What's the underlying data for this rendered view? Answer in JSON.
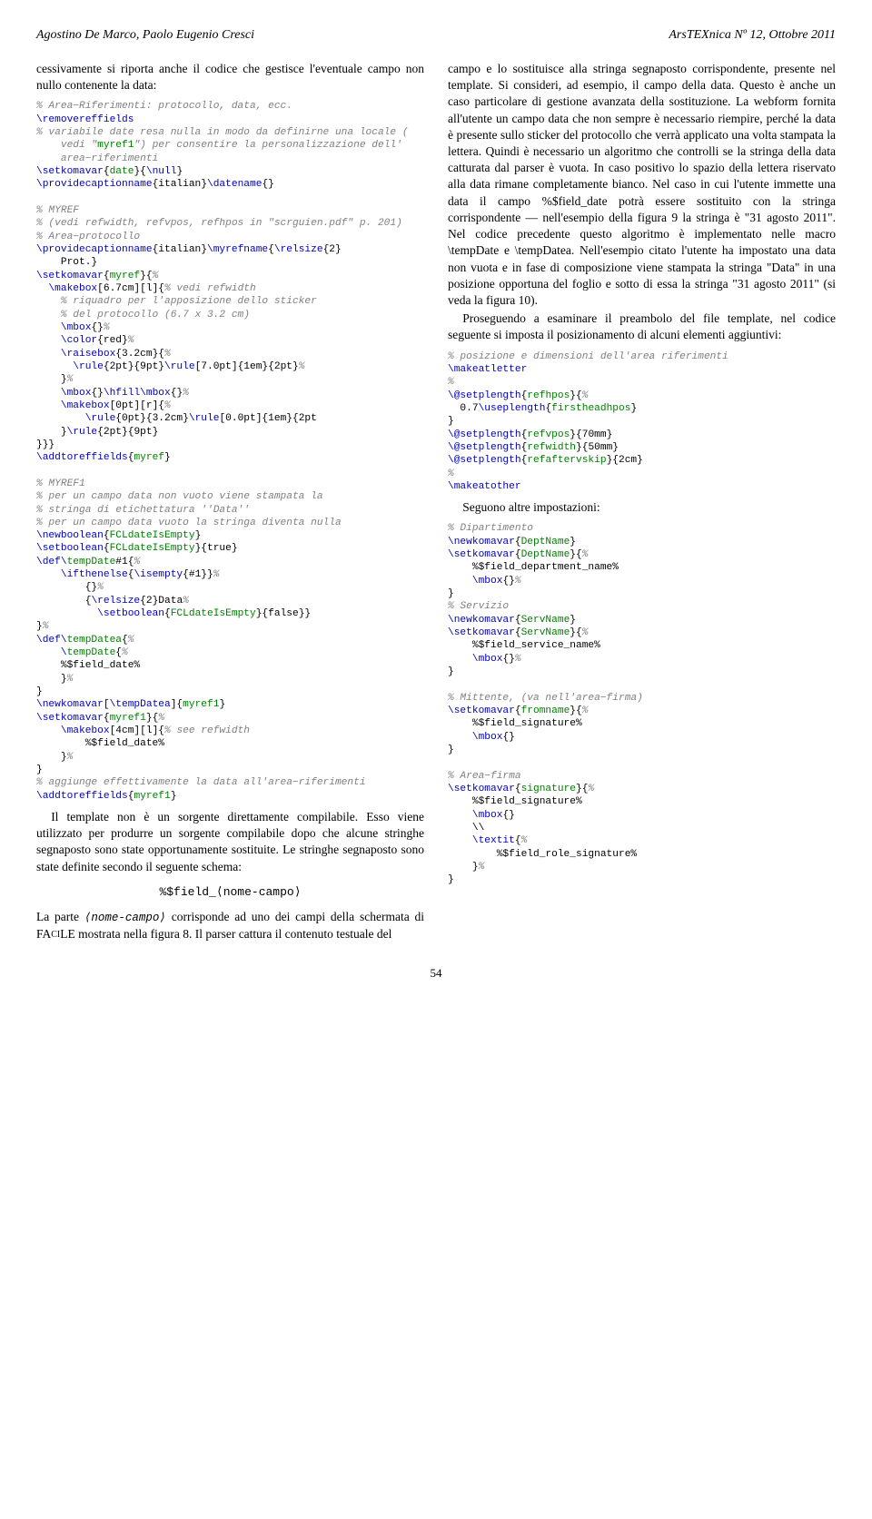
{
  "header": {
    "left": "Agostino De Marco, Paolo Eugenio Cresci",
    "right_logo": "ArsTEXnica",
    "right_rest": " Nº 12, Ottobre 2011"
  },
  "left": {
    "p1": "cessivamente si riporta anche il codice che gestisce l'eventuale campo non nullo contenente la data:",
    "code1": {
      "l1": "% Area−Riferimenti: protocollo, data, ecc.",
      "l2a": "\\removereffields",
      "l3": "% variabile date resa nulla in modo da definirne una locale (",
      "l4a": "    vedi \"",
      "l4b": "myref1",
      "l4c": "\") per consentire la personalizzazione dell'",
      "l5": "    area−riferimenti",
      "l6a": "\\setkomavar",
      "l6b": "{",
      "l6c": "date",
      "l6d": "}{",
      "l6e": "\\null",
      "l6f": "}",
      "l7a": "\\providecaptionname",
      "l7b": "{italian}",
      "l7c": "\\datename",
      "l7d": "{}",
      "blank": ""
    },
    "code2": {
      "l1": "% MYREF",
      "l2": "% (vedi refwidth, refvpos, refhpos in \"scrguien.pdf\" p. 201)",
      "l3": "% Area−protocollo",
      "l4a": "\\providecaptionname",
      "l4b": "{italian}",
      "l4c": "\\myrefname",
      "l4d": "{",
      "l4e": "\\relsize",
      "l4f": "{2}",
      "l5": "    Prot.}",
      "l6a": "\\setkomavar",
      "l6b": "{",
      "l6c": "myref",
      "l6d": "}{",
      "l6e": "%",
      "l7a": "  \\makebox",
      "l7b": "[6.7cm][l]{",
      "l7c": "% vedi refwidth",
      "l8": "    % riquadro per l'apposizione dello sticker",
      "l9": "    % del protocollo (6.7 x 3.2 cm)",
      "l10a": "    \\mbox",
      "l10b": "{}",
      "l10c": "%",
      "l11a": "    \\color",
      "l11b": "{red}",
      "l11c": "%",
      "l12a": "    \\raisebox",
      "l12b": "{3.2cm}{",
      "l12c": "%",
      "l13a": "      \\rule",
      "l13b": "{2pt}{9pt}",
      "l13c": "\\rule",
      "l13d": "[7.0pt]{1em}{2pt}",
      "l13e": "%",
      "l14a": "    }",
      "l14b": "%",
      "l15a": "    \\mbox",
      "l15b": "{}",
      "l15c": "\\hfill\\mbox",
      "l15d": "{}",
      "l15e": "%",
      "l16a": "    \\makebox",
      "l16b": "[0pt][r]{",
      "l16c": "%",
      "l17a": "        \\rule",
      "l17b": "{0pt}{3.2cm}",
      "l17c": "\\rule",
      "l17d": "[0.0pt]{1em}{2pt",
      "l18a": "    }",
      "l18b": "\\rule",
      "l18c": "{2pt}{9pt}",
      "l19": "}}}",
      "l20a": "\\addtoreffields",
      "l20b": "{",
      "l20c": "myref",
      "l20d": "}"
    },
    "code3": {
      "l1": "% MYREF1",
      "l2": "% per un campo data non vuoto viene stampata la",
      "l3": "% stringa di etichettatura ''Data''",
      "l4": "% per un campo data vuoto la stringa diventa nulla",
      "l5a": "\\newboolean",
      "l5b": "{",
      "l5c": "FCLdateIsEmpty",
      "l5d": "}",
      "l6a": "\\setboolean",
      "l6b": "{",
      "l6c": "FCLdateIsEmpty",
      "l6d": "}{true}",
      "l7a": "\\def\\",
      "l7b": "tempDate",
      "l7c": "#1{",
      "l7d": "%",
      "l8a": "    \\ifthenelse",
      "l8b": "{",
      "l8c": "\\isempty",
      "l8d": "{#1}}",
      "l8e": "%",
      "l9a": "        {}",
      "l9b": "%",
      "l10a": "        {",
      "l10b": "\\relsize",
      "l10c": "{2}Data",
      "l10d": "%",
      "l11a": "          \\setboolean",
      "l11b": "{",
      "l11c": "FCLdateIsEmpty",
      "l11d": "}{false}}",
      "l12a": "}",
      "l12b": "%",
      "l13a": "\\def\\",
      "l13b": "tempDatea",
      "l13c": "{",
      "l13d": "%",
      "l14a": "    \\",
      "l14b": "tempDate",
      "l14c": "{",
      "l14d": "%",
      "l15": "    %$field_date%",
      "l16a": "    }",
      "l16b": "%",
      "l17": "}",
      "l18a": "\\newkomavar",
      "l18b": "[",
      "l18c": "\\tempDatea",
      "l18d": "]{",
      "l18e": "myref1",
      "l18f": "}",
      "l19a": "\\setkomavar",
      "l19b": "{",
      "l19c": "myref1",
      "l19d": "}{",
      "l19e": "%",
      "l20a": "    \\makebox",
      "l20b": "[4cm][l]{",
      "l20c": "% see refwidth",
      "l21": "        %$field_date%",
      "l22a": "    }",
      "l22b": "%",
      "l23": "}",
      "l24": "% aggiunge effettivamente la data all'area−riferimenti",
      "l25a": "\\addtoreffields",
      "l25b": "{",
      "l25c": "myref1",
      "l25d": "}"
    },
    "p2": "Il template non è un sorgente direttamente compilabile. Esso viene utilizzato per produrre un sorgente compilabile dopo che alcune stringhe segnaposto sono state opportunamente sostituite. Le stringhe segnaposto sono state definite secondo il seguente schema:",
    "schema": "%$field_⟨nome-campo⟩",
    "p3a": "La parte ",
    "p3b": "⟨nome-campo⟩",
    "p3c": " corrisponde ad uno dei campi della schermata di F",
    "p3d": "A",
    "p3e": "CI",
    "p3f": "LE mostrata nella figura 8. Il parser cattura il contenuto testuale del"
  },
  "right": {
    "p1": "campo e lo sostituisce alla stringa segnaposto corrispondente, presente nel template. Si consideri, ad esempio, il campo della data. Questo è anche un caso particolare di gestione avanzata della sostituzione. La webform fornita all'utente un campo data che non sempre è necessario riempire, perché la data è presente sullo sticker del protocollo che verrà applicato una volta stampata la lettera. Quindi è necessario un algoritmo che controlli se la stringa della data catturata dal parser è vuota. In caso positivo lo spazio della lettera riservato alla data rimane completamente bianco. Nel caso in cui l'utente immette una data il campo %$field_date potrà essere sostituito con la stringa corrispondente — nell'esempio della figura 9 la stringa è \"31 agosto 2011\". Nel codice precedente questo algoritmo è implementato nelle macro \\tempDate e \\tempDatea. Nell'esempio citato l'utente ha impostato una data non vuota e in fase di composizione viene stampata la stringa \"Data\" in una posizione opportuna del foglio e sotto di essa la stringa \"31 agosto 2011\" (si veda la figura 10).",
    "p2": "Proseguendo a esaminare il preambolo del file template, nel codice seguente si imposta il posizionamento di alcuni elementi aggiuntivi:",
    "code1": {
      "l1": "% posizione e dimensioni dell'area riferimenti",
      "l2": "\\makeatletter",
      "l3": "%",
      "l4a": "\\@setplength",
      "l4b": "{",
      "l4c": "refhpos",
      "l4d": "}{",
      "l4e": "%",
      "l5a": "  0.7",
      "l5b": "\\useplength",
      "l5c": "{",
      "l5d": "firstheadhpos",
      "l5e": "}",
      "l6": "}",
      "l7a": "\\@setplength",
      "l7b": "{",
      "l7c": "refvpos",
      "l7d": "}{70mm}",
      "l8a": "\\@setplength",
      "l8b": "{",
      "l8c": "refwidth",
      "l8d": "}{50mm}",
      "l9a": "\\@setplength",
      "l9b": "{",
      "l9c": "refaftervskip",
      "l9d": "}{2cm}",
      "l10": "%",
      "l11": "\\makeatother"
    },
    "p3": "Seguono altre impostazioni:",
    "code2": {
      "l1": "% Dipartimento",
      "l2a": "\\newkomavar",
      "l2b": "{",
      "l2c": "DeptName",
      "l2d": "}",
      "l3a": "\\setkomavar",
      "l3b": "{",
      "l3c": "DeptName",
      "l3d": "}{",
      "l3e": "%",
      "l4": "    %$field_department_name%",
      "l5a": "    \\mbox",
      "l5b": "{}",
      "l5c": "%",
      "l6": "}",
      "l7": "% Servizio",
      "l8a": "\\newkomavar",
      "l8b": "{",
      "l8c": "ServName",
      "l8d": "}",
      "l9a": "\\setkomavar",
      "l9b": "{",
      "l9c": "ServName",
      "l9d": "}{",
      "l9e": "%",
      "l10": "    %$field_service_name%",
      "l11a": "    \\mbox",
      "l11b": "{}",
      "l11c": "%",
      "l12": "}"
    },
    "code3": {
      "l1": "% Mittente, (va nell'area−firma)",
      "l2a": "\\setkomavar",
      "l2b": "{",
      "l2c": "fromname",
      "l2d": "}{",
      "l2e": "%",
      "l3": "    %$field_signature%",
      "l4a": "    \\mbox",
      "l4b": "{}",
      "l5": "}"
    },
    "code4": {
      "l1": "% Area−firma",
      "l2a": "\\setkomavar",
      "l2b": "{",
      "l2c": "signature",
      "l2d": "}{",
      "l2e": "%",
      "l3": "    %$field_signature%",
      "l4a": "    \\mbox",
      "l4b": "{}",
      "l5": "    \\\\",
      "l6a": "    \\textit",
      "l6b": "{",
      "l6c": "%",
      "l7": "        %$field_role_signature%",
      "l8a": "    }",
      "l8b": "%",
      "l9": "}"
    }
  },
  "pagenum": "54"
}
